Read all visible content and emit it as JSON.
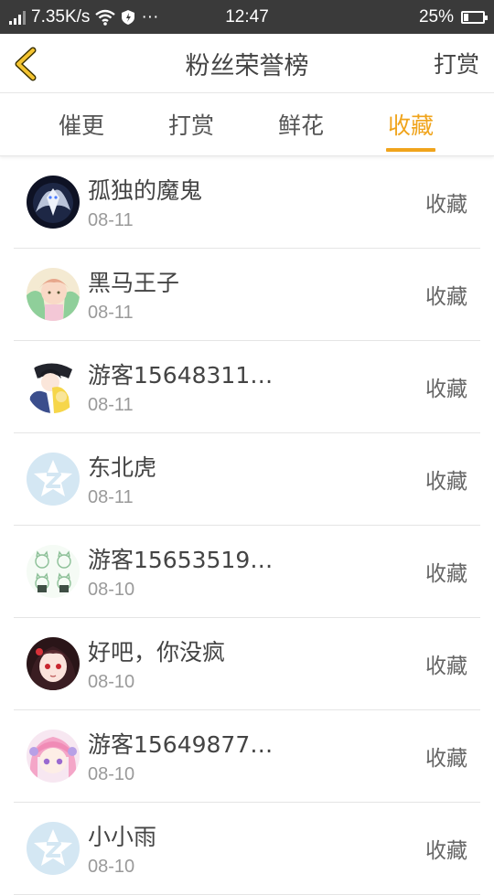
{
  "status_bar": {
    "network_speed": "7.35K/s",
    "more": "···",
    "time": "12:47",
    "battery": "25%",
    "battery_level": 0.25
  },
  "header": {
    "title": "粉丝荣誉榜",
    "right_action": "打赏"
  },
  "tabs": [
    {
      "label": "催更",
      "active": false
    },
    {
      "label": "打赏",
      "active": false
    },
    {
      "label": "鲜花",
      "active": false
    },
    {
      "label": "收藏",
      "active": true
    }
  ],
  "rows": [
    {
      "name": "孤独的魔鬼",
      "date": "08-11",
      "action": "收藏",
      "avatar": "dark-dragon-avatar"
    },
    {
      "name": "黑马王子",
      "date": "08-11",
      "action": "收藏",
      "avatar": "anime-pink-avatar"
    },
    {
      "name": "游客15648311…",
      "date": "08-11",
      "action": "收藏",
      "avatar": "anime-couple-avatar"
    },
    {
      "name": "东北虎",
      "date": "08-11",
      "action": "收藏",
      "avatar": "default-z-avatar"
    },
    {
      "name": "游客15653519…",
      "date": "08-10",
      "action": "收藏",
      "avatar": "sketch-cats-avatar"
    },
    {
      "name": "好吧，你没疯",
      "date": "08-10",
      "action": "收藏",
      "avatar": "anime-girl-dark-avatar"
    },
    {
      "name": "游客15649877…",
      "date": "08-10",
      "action": "收藏",
      "avatar": "anime-pink-hair-avatar"
    },
    {
      "name": "小小雨",
      "date": "08-10",
      "action": "收藏",
      "avatar": "default-z-avatar"
    }
  ],
  "colors": {
    "accent": "#f0a41c",
    "status_bar": "#3a3a3a",
    "default_avatar": "#d4e7f3"
  }
}
